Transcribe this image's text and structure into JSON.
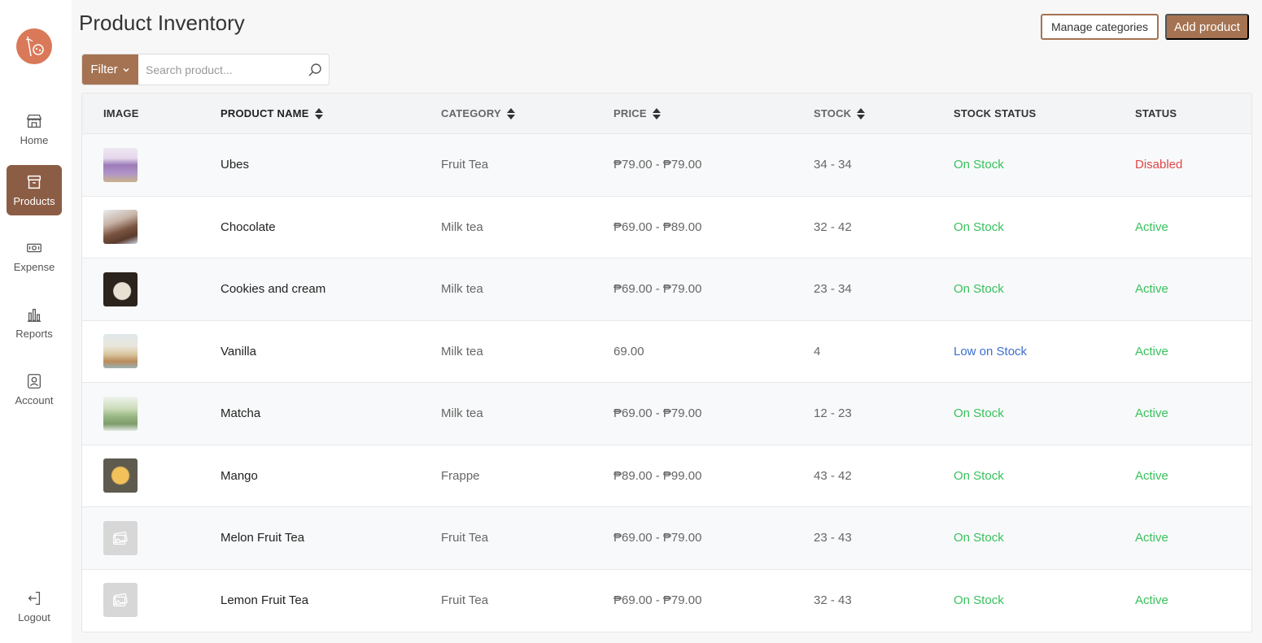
{
  "page": {
    "title": "Product Inventory",
    "manage_categories": "Manage categories",
    "add_product": "Add product"
  },
  "search": {
    "filter_label": "Filter",
    "placeholder": "Search product..."
  },
  "sidebar": {
    "items": [
      {
        "label": "Home",
        "icon": "store-icon"
      },
      {
        "label": "Products",
        "icon": "archive-box-icon"
      },
      {
        "label": "Expense",
        "icon": "cash-icon"
      },
      {
        "label": "Reports",
        "icon": "bar-chart-icon"
      },
      {
        "label": "Account",
        "icon": "user-badge-icon"
      }
    ],
    "logout": "Logout"
  },
  "table": {
    "headers": {
      "image": "IMAGE",
      "name": "PRODUCT NAME",
      "category": "CATEGORY",
      "price": "PRICE",
      "stock": "STOCK",
      "stock_status": "STOCK STATUS",
      "status": "STATUS"
    },
    "rows": [
      {
        "name": "Ubes",
        "category": "Fruit Tea",
        "price": "₱79.00 - ₱79.00",
        "stock": "34 - 34",
        "stock_status": "On Stock",
        "status": "Disabled",
        "image": "purple-drink-photo"
      },
      {
        "name": "Chocolate",
        "category": "Milk tea",
        "price": "₱69.00 - ₱89.00",
        "stock": "32 - 42",
        "stock_status": "On Stock",
        "status": "Active",
        "image": "chocolate-drink-photo"
      },
      {
        "name": "Cookies and cream",
        "category": "Milk tea",
        "price": "₱69.00 - ₱79.00",
        "stock": "23 - 34",
        "stock_status": "On Stock",
        "status": "Active",
        "image": "cookies-drink-photo"
      },
      {
        "name": "Vanilla",
        "category": "Milk tea",
        "price": "69.00",
        "stock": "4",
        "stock_status": "Low on Stock",
        "status": "Active",
        "image": "vanilla-drink-photo"
      },
      {
        "name": "Matcha",
        "category": "Milk tea",
        "price": "₱69.00 - ₱79.00",
        "stock": "12 - 23",
        "stock_status": "On Stock",
        "status": "Active",
        "image": "matcha-drink-photo"
      },
      {
        "name": "Mango",
        "category": "Frappe",
        "price": "₱89.00 - ₱99.00",
        "stock": "43 - 42",
        "stock_status": "On Stock",
        "status": "Active",
        "image": "mango-drink-photo"
      },
      {
        "name": "Melon Fruit Tea",
        "category": "Fruit Tea",
        "price": "₱69.00 - ₱79.00",
        "stock": "23 - 43",
        "stock_status": "On Stock",
        "status": "Active",
        "image": "placeholder-image-icon"
      },
      {
        "name": "Lemon Fruit Tea",
        "category": "Fruit Tea",
        "price": "₱69.00 - ₱79.00",
        "stock": "32 - 43",
        "stock_status": "On Stock",
        "status": "Active",
        "image": "placeholder-image-icon"
      }
    ]
  },
  "colors": {
    "brand": "#a57352",
    "sidebar_active": "#8c5d45",
    "on_stock": "#39c15d",
    "low_stock": "#3b6fd1",
    "disabled": "#e04848",
    "active": "#39c15d"
  }
}
